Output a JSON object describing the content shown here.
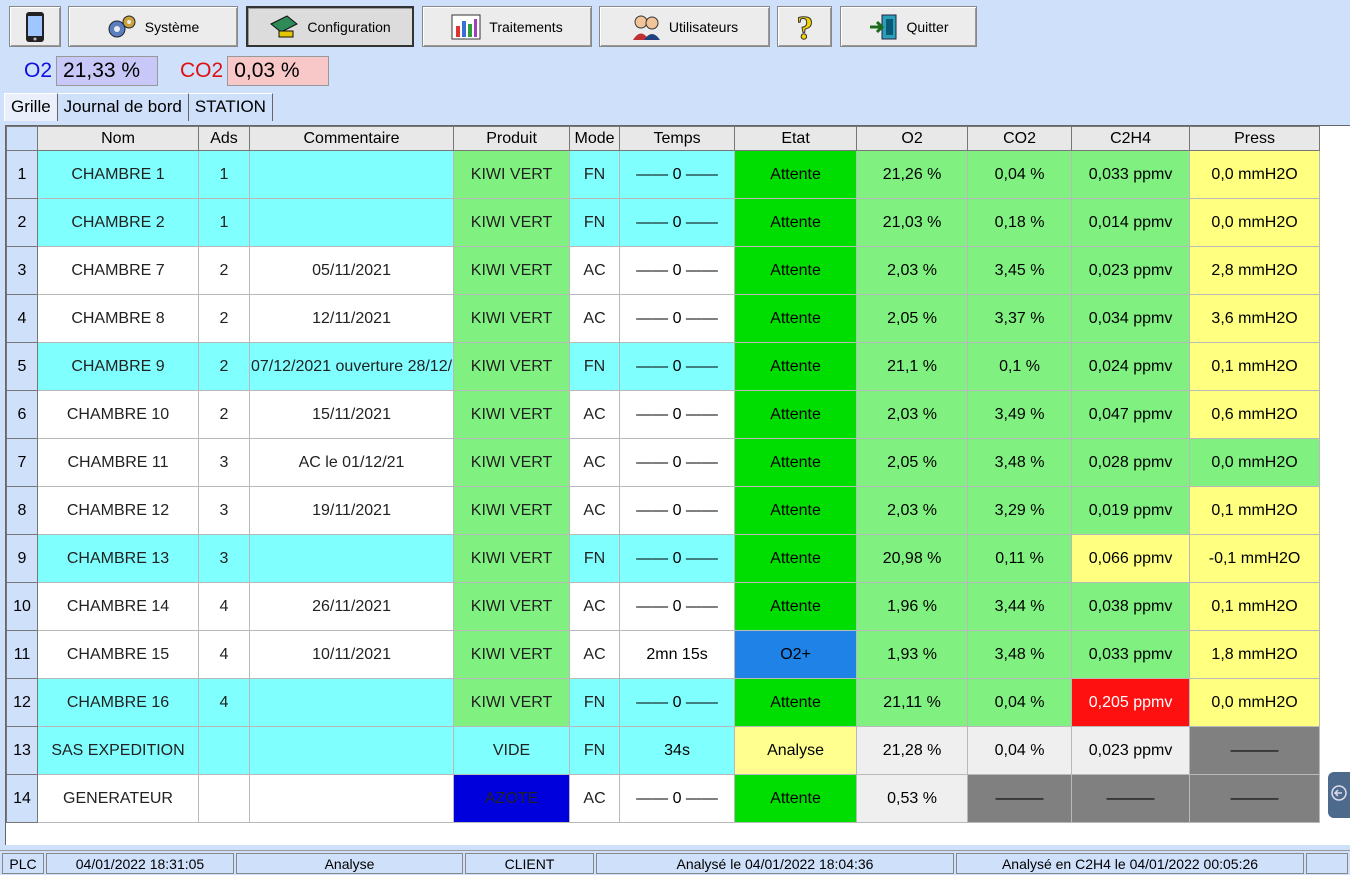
{
  "toolbar": {
    "buttons": [
      {
        "label": "",
        "icon": "phone-icon"
      },
      {
        "label": "Système",
        "icon": "gears-icon"
      },
      {
        "label": "Configuration",
        "icon": "config-icon"
      },
      {
        "label": "Traitements",
        "icon": "chart-icon"
      },
      {
        "label": "Utilisateurs",
        "icon": "users-icon"
      },
      {
        "label": "",
        "icon": "question-icon"
      },
      {
        "label": "Quitter",
        "icon": "exit-door-icon"
      }
    ]
  },
  "gas": {
    "o2_label": "O2",
    "o2_value": "21,33 %",
    "co2_label": "CO2",
    "co2_value": "0,03 %"
  },
  "tabs": [
    "Grille",
    "Journal de bord",
    "STATION"
  ],
  "grid": {
    "headers": [
      "Nom",
      "Ads",
      "Commentaire",
      "Produit",
      "Mode",
      "Temps",
      "Etat",
      "O2",
      "CO2",
      "C2H4",
      "Press"
    ],
    "rows": [
      {
        "num": "1",
        "nom": "CHAMBRE 1",
        "ads": "1",
        "commentaire": "",
        "produit": "KIWI VERT",
        "mode": "FN",
        "temps": "—— 0 ——",
        "etat": "Attente",
        "o2": "21,26 %",
        "co2": "0,04 %",
        "c2h4": "0,033 ppmv",
        "press": "0,0 mmH2O"
      },
      {
        "num": "2",
        "nom": "CHAMBRE 2",
        "ads": "1",
        "commentaire": "",
        "produit": "KIWI VERT",
        "mode": "FN",
        "temps": "—— 0 ——",
        "etat": "Attente",
        "o2": "21,03 %",
        "co2": "0,18 %",
        "c2h4": "0,014 ppmv",
        "press": "0,0 mmH2O"
      },
      {
        "num": "3",
        "nom": "CHAMBRE 7",
        "ads": "2",
        "commentaire": "05/11/2021",
        "produit": "KIWI VERT",
        "mode": "AC",
        "temps": "—— 0 ——",
        "etat": "Attente",
        "o2": "2,03 %",
        "co2": "3,45 %",
        "c2h4": "0,023 ppmv",
        "press": "2,8 mmH2O"
      },
      {
        "num": "4",
        "nom": "CHAMBRE 8",
        "ads": "2",
        "commentaire": "12/11/2021",
        "produit": "KIWI VERT",
        "mode": "AC",
        "temps": "—— 0 ——",
        "etat": "Attente",
        "o2": "2,05 %",
        "co2": "3,37 %",
        "c2h4": "0,034 ppmv",
        "press": "3,6 mmH2O"
      },
      {
        "num": "5",
        "nom": "CHAMBRE 9",
        "ads": "2",
        "commentaire": "07/12/2021 ouverture 28/12/",
        "produit": "KIWI VERT",
        "mode": "FN",
        "temps": "—— 0 ——",
        "etat": "Attente",
        "o2": "21,1 %",
        "co2": "0,1 %",
        "c2h4": "0,024 ppmv",
        "press": "0,1 mmH2O"
      },
      {
        "num": "6",
        "nom": "CHAMBRE 10",
        "ads": "2",
        "commentaire": "15/11/2021",
        "produit": "KIWI VERT",
        "mode": "AC",
        "temps": "—— 0 ——",
        "etat": "Attente",
        "o2": "2,03 %",
        "co2": "3,49 %",
        "c2h4": "0,047 ppmv",
        "press": "0,6 mmH2O"
      },
      {
        "num": "7",
        "nom": "CHAMBRE 11",
        "ads": "3",
        "commentaire": "AC le 01/12/21",
        "produit": "KIWI VERT",
        "mode": "AC",
        "temps": "—— 0 ——",
        "etat": "Attente",
        "o2": "2,05 %",
        "co2": "3,48 %",
        "c2h4": "0,028 ppmv",
        "press": "0,0 mmH2O"
      },
      {
        "num": "8",
        "nom": "CHAMBRE 12",
        "ads": "3",
        "commentaire": "19/11/2021",
        "produit": "KIWI VERT",
        "mode": "AC",
        "temps": "—— 0 ——",
        "etat": "Attente",
        "o2": "2,03 %",
        "co2": "3,29 %",
        "c2h4": "0,019 ppmv",
        "press": "0,1 mmH2O"
      },
      {
        "num": "9",
        "nom": "CHAMBRE 13",
        "ads": "3",
        "commentaire": "",
        "produit": "KIWI VERT",
        "mode": "FN",
        "temps": "—— 0 ——",
        "etat": "Attente",
        "o2": "20,98 %",
        "co2": "0,11 %",
        "c2h4": "0,066 ppmv",
        "press": "-0,1 mmH2O"
      },
      {
        "num": "10",
        "nom": "CHAMBRE 14",
        "ads": "4",
        "commentaire": "26/11/2021",
        "produit": "KIWI VERT",
        "mode": "AC",
        "temps": "—— 0 ——",
        "etat": "Attente",
        "o2": "1,96 %",
        "co2": "3,44 %",
        "c2h4": "0,038 ppmv",
        "press": "0,1 mmH2O"
      },
      {
        "num": "11",
        "nom": "CHAMBRE 15",
        "ads": "4",
        "commentaire": "10/11/2021",
        "produit": "KIWI VERT",
        "mode": "AC",
        "temps": "2mn 15s",
        "etat": "O2+",
        "o2": "1,93 %",
        "co2": "3,48 %",
        "c2h4": "0,033 ppmv",
        "press": "1,8 mmH2O"
      },
      {
        "num": "12",
        "nom": "CHAMBRE 16",
        "ads": "4",
        "commentaire": "",
        "produit": "KIWI VERT",
        "mode": "FN",
        "temps": "—— 0 ——",
        "etat": "Attente",
        "o2": "21,11 %",
        "co2": "0,04 %",
        "c2h4": "0,205 ppmv",
        "press": "0,0 mmH2O"
      },
      {
        "num": "13",
        "nom": "SAS EXPEDITION",
        "ads": "",
        "commentaire": "",
        "produit": "VIDE",
        "mode": "FN",
        "temps": "34s",
        "etat": "Analyse",
        "o2": "21,28 %",
        "co2": "0,04 %",
        "c2h4": "0,023 ppmv",
        "press": "———"
      },
      {
        "num": "14",
        "nom": "GENERATEUR",
        "ads": "",
        "commentaire": "",
        "produit": "AZOTE",
        "mode": "AC",
        "temps": "—— 0 ——",
        "etat": "Attente",
        "o2": "0,53 %",
        "co2": "———",
        "c2h4": "———",
        "press": "———"
      }
    ]
  },
  "status": [
    "PLC",
    "04/01/2022 18:31:05",
    "Analyse",
    "CLIENT",
    "Analysé le 04/01/2022 18:04:36",
    "Analysé en C2H4 le 04/01/2022 00:05:26"
  ],
  "colors": {
    "cyan": "#80ffff",
    "green_cell": "#80f080",
    "attente": "#00dd00",
    "o2plus": "#1e82e6",
    "analyse": "#ffff90",
    "yellow": "#ffff80",
    "red": "#ff1010",
    "grey": "#808080",
    "azote": "#0000dd",
    "light_grey": "#efefef",
    "panel": "#cfe0fb"
  }
}
